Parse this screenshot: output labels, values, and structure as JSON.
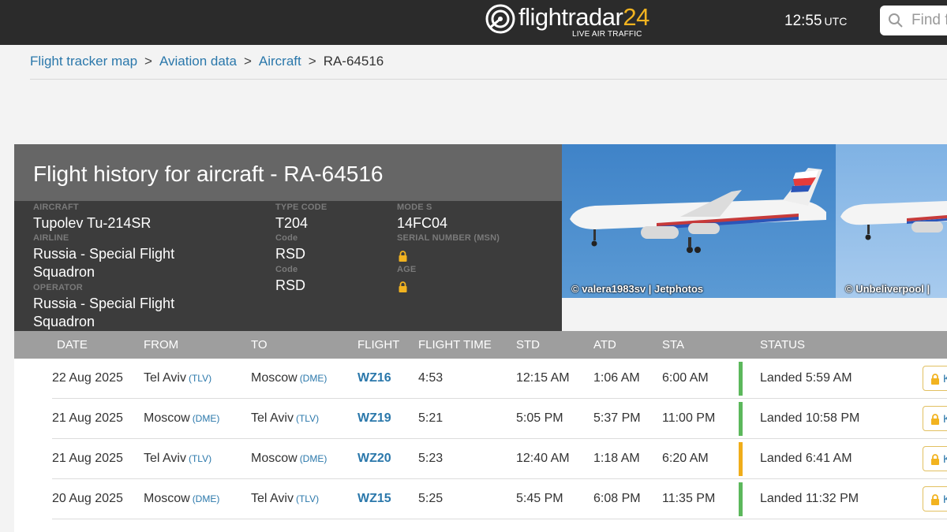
{
  "header": {
    "logo_word": "flightradar",
    "logo_num": "24",
    "logo_sub": "LIVE AIR TRAFFIC",
    "clock": "12:55",
    "clock_zone": "UTC",
    "search_placeholder": "Find f",
    "brand_color": "#f2b320"
  },
  "breadcrumb": {
    "items": [
      "Flight tracker map",
      "Aviation data",
      "Aircraft"
    ],
    "separator": ">",
    "current": "RA-64516"
  },
  "aircraft": {
    "title": "Flight history for aircraft - RA-64516",
    "aircraft_label": "AIRCRAFT",
    "aircraft_value": "Tupolev Tu-214SR",
    "airline_label": "AIRLINE",
    "airline_value": "Russia - Special Flight Squadron",
    "operator_label": "OPERATOR",
    "operator_value": "Russia - Special Flight Squadron",
    "type_code_label": "TYPE CODE",
    "type_code_value": "T204",
    "code_label_1": "Code",
    "code_value_1": "RSD",
    "code_label_2": "Code",
    "code_value_2": "RSD",
    "mode_s_label": "MODE S",
    "mode_s_value": "14FC04",
    "serial_label": "SERIAL NUMBER (MSN)",
    "age_label": "AGE",
    "lock_icon": "lock-icon"
  },
  "photos": [
    {
      "credit": "© valera1983sv | Jetphotos"
    },
    {
      "credit": "© Unbeliverpool |"
    }
  ],
  "table": {
    "columns": [
      "DATE",
      "FROM",
      "TO",
      "FLIGHT",
      "FLIGHT TIME",
      "STD",
      "ATD",
      "STA",
      "STATUS"
    ],
    "rows": [
      {
        "date": "22 Aug 2025",
        "from": "Tel Aviv",
        "from_code": "(TLV)",
        "to": "Moscow",
        "to_code": "(DME)",
        "flight": "WZ16",
        "flight_time": "4:53",
        "std": "12:15 AM",
        "atd": "1:06 AM",
        "sta": "6:00 AM",
        "status": "Landed 5:59 AM",
        "status_color": "#5cb85c",
        "action": "K"
      },
      {
        "date": "21 Aug 2025",
        "from": "Moscow",
        "from_code": "(DME)",
        "to": "Tel Aviv",
        "to_code": "(TLV)",
        "flight": "WZ19",
        "flight_time": "5:21",
        "std": "5:05 PM",
        "atd": "5:37 PM",
        "sta": "11:00 PM",
        "status": "Landed 10:58 PM",
        "status_color": "#5cb85c",
        "action": "K"
      },
      {
        "date": "21 Aug 2025",
        "from": "Tel Aviv",
        "from_code": "(TLV)",
        "to": "Moscow",
        "to_code": "(DME)",
        "flight": "WZ20",
        "flight_time": "5:23",
        "std": "12:40 AM",
        "atd": "1:18 AM",
        "sta": "6:20 AM",
        "status": "Landed 6:41 AM",
        "status_color": "#f0ad1a",
        "action": "K"
      },
      {
        "date": "20 Aug 2025",
        "from": "Moscow",
        "from_code": "(DME)",
        "to": "Tel Aviv",
        "to_code": "(TLV)",
        "flight": "WZ15",
        "flight_time": "5:25",
        "std": "5:45 PM",
        "atd": "6:08 PM",
        "sta": "11:35 PM",
        "status": "Landed 11:32 PM",
        "status_color": "#5cb85c",
        "action": "K"
      }
    ]
  }
}
